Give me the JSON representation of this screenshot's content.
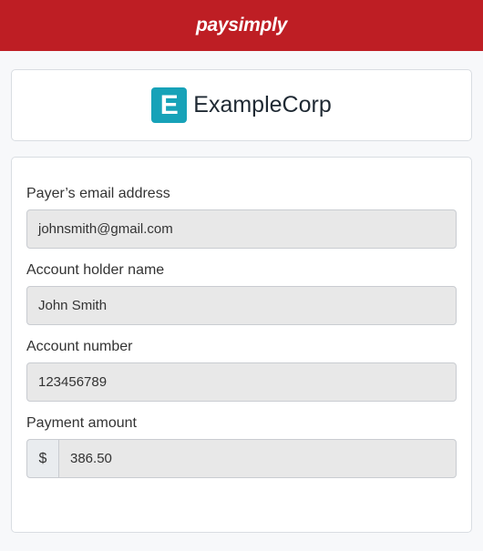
{
  "header": {
    "brand": "paysimply",
    "bg_color": "#be1e24"
  },
  "merchant": {
    "icon_letter": "E",
    "name": "ExampleCorp",
    "icon_color": "#17a2b8"
  },
  "form": {
    "email": {
      "label": "Payer’s email address",
      "value": "johnsmith@gmail.com"
    },
    "holder": {
      "label": "Account holder name",
      "value": "John Smith"
    },
    "account": {
      "label": "Account number",
      "value": "123456789"
    },
    "amount": {
      "label": "Payment amount",
      "currency": "$",
      "value": "386.50"
    }
  }
}
